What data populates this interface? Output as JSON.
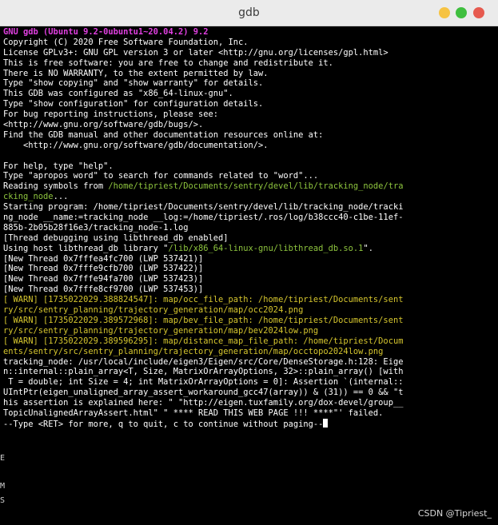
{
  "window": {
    "title": "gdb"
  },
  "terminal": {
    "lines": [
      {
        "segments": [
          {
            "text": "GNU gdb (Ubuntu 9.2-0ubuntu1~20.04.2) 9.2",
            "color": "magenta"
          }
        ]
      },
      {
        "segments": [
          {
            "text": "Copyright (C) 2020 Free Software Foundation, Inc.",
            "color": "white"
          }
        ]
      },
      {
        "segments": [
          {
            "text": "License GPLv3+: GNU GPL version 3 or later <http://gnu.org/licenses/gpl.html>",
            "color": "white"
          }
        ]
      },
      {
        "segments": [
          {
            "text": "This is free software: you are free to change and redistribute it.",
            "color": "white"
          }
        ]
      },
      {
        "segments": [
          {
            "text": "There is NO WARRANTY, to the extent permitted by law.",
            "color": "white"
          }
        ]
      },
      {
        "segments": [
          {
            "text": "Type \"show copying\" and \"show warranty\" for details.",
            "color": "white"
          }
        ]
      },
      {
        "segments": [
          {
            "text": "This GDB was configured as \"x86_64-linux-gnu\".",
            "color": "white"
          }
        ]
      },
      {
        "segments": [
          {
            "text": "Type \"show configuration\" for configuration details.",
            "color": "white"
          }
        ]
      },
      {
        "segments": [
          {
            "text": "For bug reporting instructions, please see:",
            "color": "white"
          }
        ]
      },
      {
        "segments": [
          {
            "text": "<http://www.gnu.org/software/gdb/bugs/>.",
            "color": "white"
          }
        ]
      },
      {
        "segments": [
          {
            "text": "Find the GDB manual and other documentation resources online at:",
            "color": "white"
          }
        ]
      },
      {
        "segments": [
          {
            "text": "    <http://www.gnu.org/software/gdb/documentation/>.",
            "color": "white"
          }
        ]
      },
      {
        "segments": [
          {
            "text": "",
            "color": "white"
          }
        ]
      },
      {
        "segments": [
          {
            "text": "For help, type \"help\".",
            "color": "white"
          }
        ]
      },
      {
        "segments": [
          {
            "text": "Type \"apropos word\" to search for commands related to \"word\"...",
            "color": "white"
          }
        ]
      },
      {
        "segments": [
          {
            "text": "Reading symbols from ",
            "color": "white"
          },
          {
            "text": "/home/tipriest/Documents/sentry/devel/lib/tracking_node/tra",
            "color": "green"
          }
        ]
      },
      {
        "segments": [
          {
            "text": "cking_node",
            "color": "green"
          },
          {
            "text": "...",
            "color": "white"
          }
        ]
      },
      {
        "segments": [
          {
            "text": "Starting program: /home/tipriest/Documents/sentry/devel/lib/tracking_node/tracki",
            "color": "white"
          }
        ]
      },
      {
        "segments": [
          {
            "text": "ng_node __name:=tracking_node __log:=/home/tipriest/.ros/log/b38ccc40-c1be-11ef-",
            "color": "white"
          }
        ]
      },
      {
        "segments": [
          {
            "text": "885b-2b05b28f16e3/tracking_node-1.log",
            "color": "white"
          }
        ]
      },
      {
        "segments": [
          {
            "text": "[Thread debugging using libthread_db enabled]",
            "color": "white"
          }
        ]
      },
      {
        "segments": [
          {
            "text": "Using host libthread_db library \"",
            "color": "white"
          },
          {
            "text": "/lib/x86_64-linux-gnu/libthread_db.so.1",
            "color": "green"
          },
          {
            "text": "\".",
            "color": "white"
          }
        ]
      },
      {
        "segments": [
          {
            "text": "[New Thread 0x7fffea4fc700 (LWP 537421)]",
            "color": "white"
          }
        ]
      },
      {
        "segments": [
          {
            "text": "[New Thread 0x7fffe9cfb700 (LWP 537422)]",
            "color": "white"
          }
        ]
      },
      {
        "segments": [
          {
            "text": "[New Thread 0x7fffe94fa700 (LWP 537423)]",
            "color": "white"
          }
        ]
      },
      {
        "segments": [
          {
            "text": "[New Thread 0x7fffe8cf9700 (LWP 537453)]",
            "color": "white"
          }
        ]
      },
      {
        "segments": [
          {
            "text": "[ WARN] [1735022029.388824547]: map/occ_file_path: /home/tipriest/Documents/sent",
            "color": "yellow"
          }
        ]
      },
      {
        "segments": [
          {
            "text": "ry/src/sentry_planning/trajectory_generation/map/occ2024.png",
            "color": "yellow"
          }
        ]
      },
      {
        "segments": [
          {
            "text": "[ WARN] [1735022029.389572968]: map/bev_file_path: /home/tipriest/Documents/sent",
            "color": "yellow"
          }
        ]
      },
      {
        "segments": [
          {
            "text": "ry/src/sentry_planning/trajectory_generation/map/bev2024low.png",
            "color": "yellow"
          }
        ]
      },
      {
        "segments": [
          {
            "text": "[ WARN] [1735022029.389596295]: map/distance_map_file_path: /home/tipriest/Docum",
            "color": "yellow"
          }
        ]
      },
      {
        "segments": [
          {
            "text": "ents/sentry/src/sentry_planning/trajectory_generation/map/occtopo2024low.png",
            "color": "yellow"
          }
        ]
      },
      {
        "segments": [
          {
            "text": "tracking_node: /usr/local/include/eigen3/Eigen/src/Core/DenseStorage.h:128: Eige",
            "color": "white"
          }
        ]
      },
      {
        "segments": [
          {
            "text": "n::internal::plain_array<T, Size, MatrixOrArrayOptions, 32>::plain_array() [with",
            "color": "white"
          }
        ]
      },
      {
        "segments": [
          {
            "text": " T = double; int Size = 4; int MatrixOrArrayOptions = 0]: Assertion `(internal::",
            "color": "white"
          }
        ]
      },
      {
        "segments": [
          {
            "text": "UIntPtr(eigen_unaligned_array_assert_workaround_gcc47(array)) & (31)) == 0 && \"t",
            "color": "white"
          }
        ]
      },
      {
        "segments": [
          {
            "text": "his assertion is explained here: \" \"http://eigen.tuxfamily.org/dox-devel/group__",
            "color": "white"
          }
        ]
      },
      {
        "segments": [
          {
            "text": "TopicUnalignedArrayAssert.html\" \" **** READ THIS WEB PAGE !!! ****\"' failed.",
            "color": "white"
          }
        ]
      },
      {
        "segments": [
          {
            "text": "--Type <RET> for more, q to quit, c to continue without paging--",
            "color": "white"
          }
        ]
      }
    ],
    "prompt_line_index": 38
  },
  "side_fragments": [
    "E",
    "M",
    "S"
  ],
  "watermark": "CSDN @Tipriest_",
  "colors": {
    "magenta": "#e040e0",
    "green": "#8ec53e",
    "yellow": "#d6c62e",
    "white": "#ffffff",
    "background": "#000000",
    "titlebar": "#ebebeb"
  }
}
